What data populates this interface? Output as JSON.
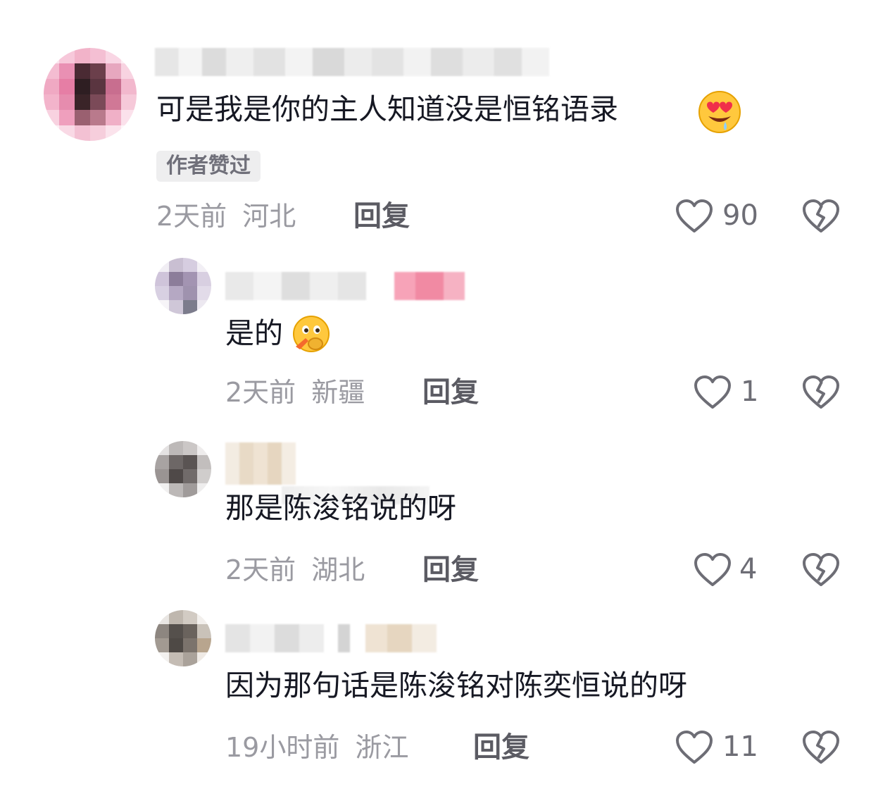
{
  "comments": [
    {
      "text": "可是我是你的主人知道没是恒铭语录",
      "emoji": "heart-eyes-emoji",
      "badge": "作者赞过",
      "time": "2天前",
      "location": "河北",
      "reply_label": "回复",
      "likes": "90"
    }
  ],
  "replies": [
    {
      "text": "是的",
      "emoji": "shy-peek-emoji",
      "time": "2天前",
      "location": "新疆",
      "reply_label": "回复",
      "likes": "1"
    },
    {
      "text": "那是陈浚铭说的呀",
      "time": "2天前",
      "location": "湖北",
      "reply_label": "回复",
      "likes": "4"
    },
    {
      "text": "因为那句话是陈浚铭对陈奕恒说的呀",
      "time": "19小时前",
      "location": "浙江",
      "reply_label": "回复",
      "likes": "11"
    }
  ],
  "colors": {
    "text": "#161823",
    "meta": "#9a9aa1",
    "reply": "#5b5b63",
    "badge_bg": "#eeeeef"
  },
  "icons": {
    "like": "heart-outline-icon",
    "dislike": "broken-heart-icon"
  }
}
